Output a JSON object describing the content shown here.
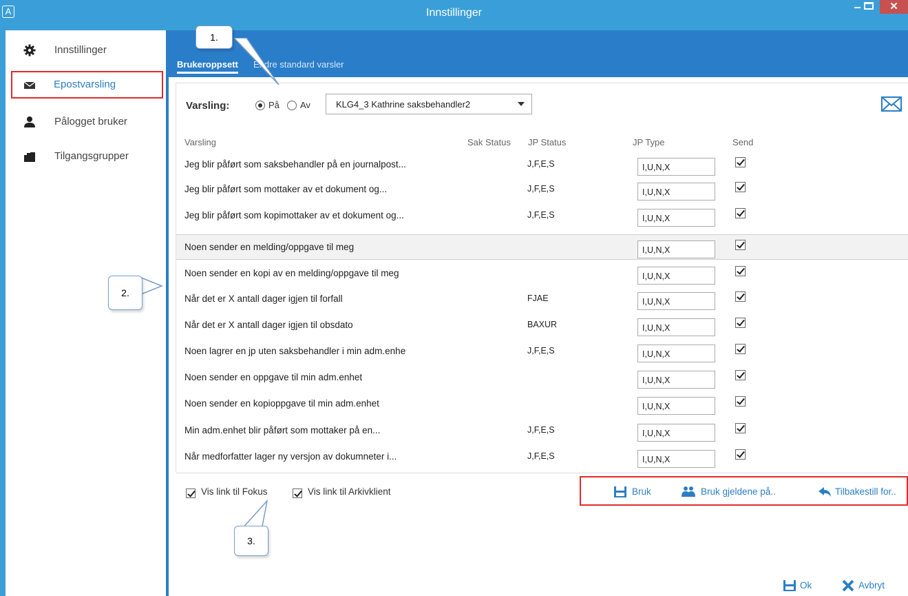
{
  "window": {
    "title": "Innstillinger",
    "app_icon": "A"
  },
  "sidebar": {
    "items": [
      {
        "label": "Innstillinger",
        "icon": "gear-icon"
      },
      {
        "label": "Epostvarsling",
        "icon": "envelope-icon",
        "active": true
      },
      {
        "label": "Pålogget bruker",
        "icon": "user-icon"
      },
      {
        "label": "Tilgangsgrupper",
        "icon": "group-icon"
      }
    ]
  },
  "tabs": [
    {
      "label": "Brukeroppsett",
      "selected": true
    },
    {
      "label": "Endre standard varsler",
      "selected": false
    }
  ],
  "varsling": {
    "label": "Varsling:",
    "on_label": "På",
    "off_label": "Av",
    "selected": "På",
    "user_value": "KLG4_3  Kathrine saksbehandler2"
  },
  "table": {
    "headers": {
      "varsling": "Varsling",
      "sak_status": "Sak Status",
      "jp_status": "JP Status",
      "jp_type": "JP Type",
      "send": "Send"
    },
    "rows": [
      {
        "text": "Jeg blir påført som saksbehandler på en journalpost...",
        "jp_status": "J,F,E,S",
        "jp_type": "I,U,N,X",
        "send": true
      },
      {
        "text": "Jeg blir påført som mottaker av et dokument og...",
        "jp_status": "J,F,E,S",
        "jp_type": "I,U,N,X",
        "send": true
      },
      {
        "text": "Jeg blir påført som kopimottaker av et dokument og...",
        "jp_status": "J,F,E,S",
        "jp_type": "I,U,N,X",
        "send": true
      },
      {
        "text": "Noen sender en melding/oppgave til meg",
        "jp_status": "",
        "jp_type": "I,U,N,X",
        "send": true,
        "selected": true
      },
      {
        "text": "Noen sender en kopi av en melding/oppgave til meg",
        "jp_status": "",
        "jp_type": "I,U,N,X",
        "send": true
      },
      {
        "text": "Når det er X antall dager igjen til forfall",
        "jp_status": "FJAE",
        "jp_type": "I,U,N,X",
        "send": true
      },
      {
        "text": "Når det er X antall dager igjen til obsdato",
        "jp_status": "BAXUR",
        "jp_type": "I,U,N,X",
        "send": true
      },
      {
        "text": "Noen lagrer en jp uten saksbehandler i min adm.enhe",
        "jp_status": "J,F,E,S",
        "jp_type": "I,U,N,X",
        "send": true
      },
      {
        "text": "Noen sender en oppgave til min adm.enhet",
        "jp_status": "",
        "jp_type": "I,U,N,X",
        "send": true
      },
      {
        "text": "Noen sender en kopioppgave til min adm.enhet",
        "jp_status": "",
        "jp_type": "I,U,N,X",
        "send": true
      },
      {
        "text": "Min adm.enhet blir påført som mottaker på en...",
        "jp_status": "J,F,E,S",
        "jp_type": "I,U,N,X",
        "send": true
      },
      {
        "text": "Når medforfatter lager ny versjon av dokumneter i...",
        "jp_status": "J,F,E,S",
        "jp_type": "I,U,N,X",
        "send": true
      }
    ]
  },
  "bottom": {
    "fokus_label": "Vis link til Fokus",
    "arkiv_label": "Vis link til Arkivklient",
    "fokus_checked": true,
    "arkiv_checked": true
  },
  "actions": {
    "bruk": "Bruk",
    "bruk_gjeldende": "Bruk gjeldene på..",
    "tilbakestill": "Tilbakestill for..",
    "ok": "Ok",
    "avbryt": "Avbryt"
  },
  "callouts": {
    "c1": "1.",
    "c2": "2.",
    "c3": "3."
  },
  "colors": {
    "accent": "#2a7dc9",
    "titlebar": "#3a9fd8",
    "highlight": "#e02a2a",
    "close": "#c75050"
  }
}
